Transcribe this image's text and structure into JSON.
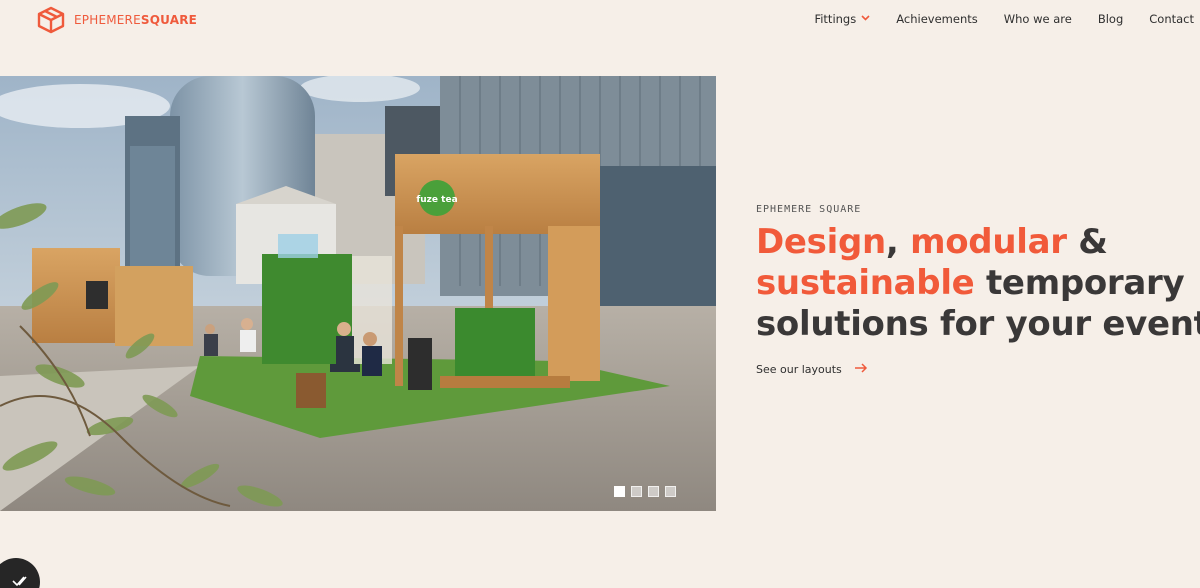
{
  "brand": {
    "name_part1": "EPHEMERE",
    "name_part2": "SQUARE",
    "color": "#ef5a3c"
  },
  "nav": {
    "items": [
      {
        "label": "Fittings",
        "has_dropdown": true
      },
      {
        "label": "Achievements"
      },
      {
        "label": "Who we are"
      },
      {
        "label": "Blog"
      },
      {
        "label": "Contact"
      }
    ]
  },
  "hero": {
    "eyebrow": "EPHEMERE SQUARE",
    "headline": {
      "w1": "Design",
      "w2": ",",
      "w3": "modular",
      "w4": "&",
      "w5": "sustainable",
      "w6": "temporary",
      "w7": "solutions for your events"
    },
    "cta_label": "See our layouts",
    "image_alt": "Modular wooden kiosks with green turf and people seated on deck chairs in a business district plaza",
    "slider": {
      "count": 4,
      "active_index": 0
    },
    "kiosk_sign": "fuze tea"
  },
  "colors": {
    "accent": "#f15a3a",
    "background": "#f6efe8",
    "text": "#3a3838"
  },
  "icons": {
    "logo": "cube-logo-icon",
    "dropdown": "chevron-down-icon",
    "cta": "arrow-right-icon",
    "badge": "check-icon"
  }
}
